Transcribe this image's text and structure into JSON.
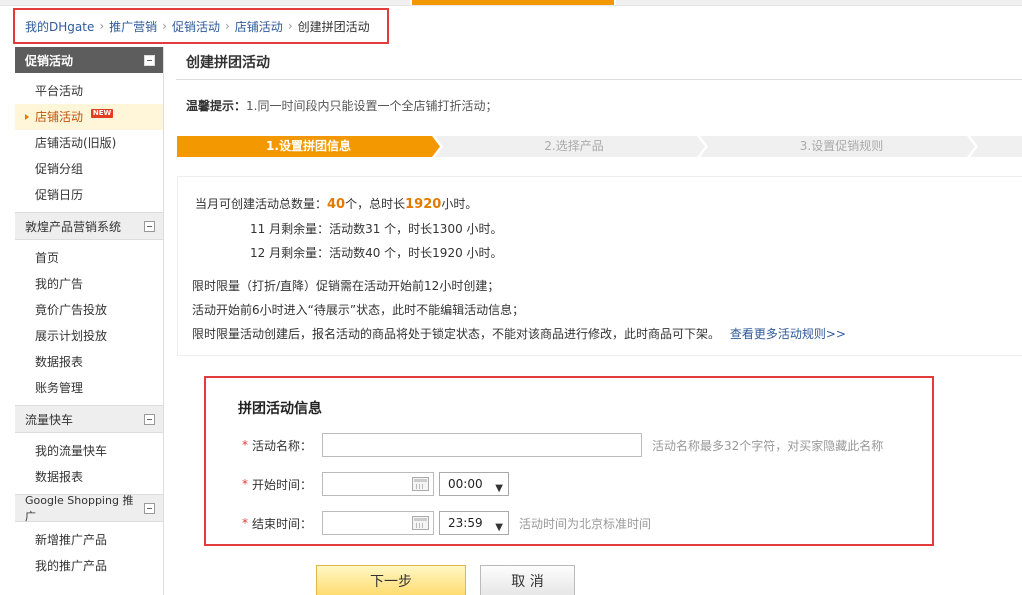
{
  "breadcrumb": {
    "items": [
      "我的DHgate",
      "推广营销",
      "促销活动",
      "店铺活动"
    ],
    "current": "创建拼团活动",
    "separator": "›"
  },
  "sidebar": {
    "header": "促销活动",
    "promo_items": [
      {
        "label": "平台活动"
      },
      {
        "label": "店铺活动",
        "badge": "NEW",
        "active": true
      },
      {
        "label": "店铺活动(旧版)"
      },
      {
        "label": "促销分组"
      },
      {
        "label": "促销日历"
      }
    ],
    "group_marketing": {
      "title": "敦煌产品营销系统",
      "items": [
        "首页",
        "我的广告",
        "竟价广告投放",
        "展示计划投放",
        "数据报表",
        "账务管理"
      ]
    },
    "group_traffic": {
      "title": "流量快车",
      "items": [
        "我的流量快车",
        "数据报表"
      ]
    },
    "group_google": {
      "title": "Google Shopping 推广",
      "items": [
        "新增推广产品",
        "我的推广产品"
      ]
    }
  },
  "main": {
    "title": "创建拼团活动",
    "tip_label": "温馨提示：",
    "tip_text": "1.同一时间段内只能设置一个全店铺打折活动；",
    "steps": [
      "1.设置拼团信息",
      "2.选择产品",
      "3.设置促销规则"
    ],
    "info": {
      "total_prefix": "当月可创建活动总数量：",
      "total_count": "40",
      "total_mid": "个，总时长",
      "total_hours": "1920",
      "total_suffix": "小时。",
      "nov_line": "11 月剩余量：活动数31 个，时长1300 小时。",
      "dec_line": "12 月剩余量：活动数40 个，时长1920 小时。",
      "rule1": "限时限量（打折/直降）促销需在活动开始前12小时创建；",
      "rule2": "活动开始前6小时进入“待展示”状态，此时不能编辑活动信息；",
      "rule3": "限时限量活动创建后，报名活动的商品将处于锁定状态，不能对该商品进行修改，此时商品可下架。",
      "more_rules_link": "查看更多活动规则>>"
    },
    "form": {
      "title": "拼团活动信息",
      "required_mark": "*",
      "name_label": "活动名称：",
      "name_value": "",
      "name_hint": "活动名称最多32个字符，对买家隐藏此名称",
      "start_label": "开始时间：",
      "start_date": "",
      "start_time": "00:00",
      "end_label": "结束时间：",
      "end_date": "",
      "end_time": "23:59",
      "time_hint": "活动时间为北京标准时间"
    },
    "buttons": {
      "next": "下一步",
      "cancel": "取 消"
    }
  },
  "colors": {
    "accent_orange": "#f39800",
    "highlight_border": "#e23b3b",
    "link_blue": "#2f5a9a",
    "sidebar_header": "#5d5d5d"
  }
}
